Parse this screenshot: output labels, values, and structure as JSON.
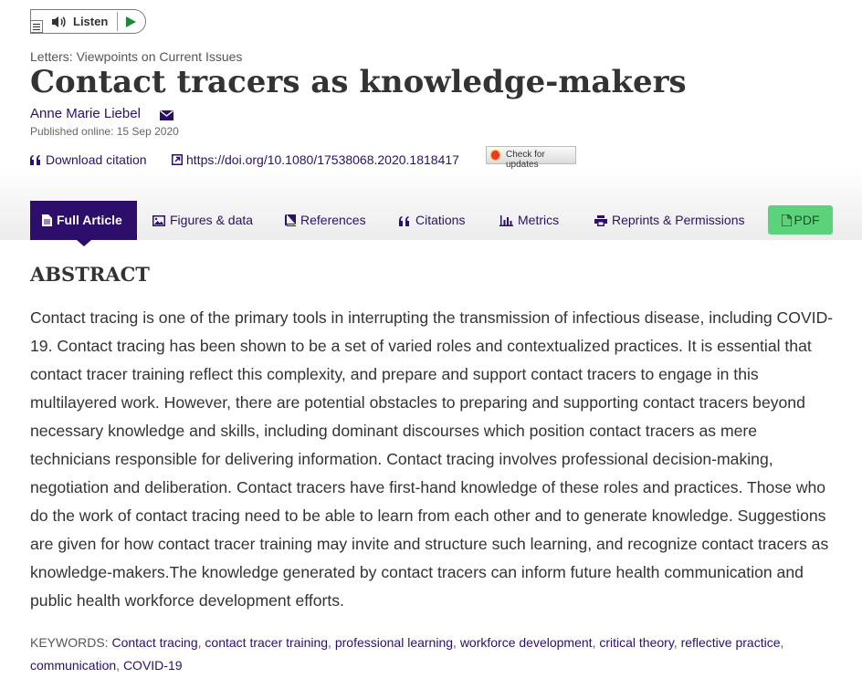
{
  "listen": {
    "label": "Listen"
  },
  "article": {
    "section_type": "Letters: Viewpoints on Current Issues",
    "title": "Contact tracers as knowledge-makers",
    "author": "Anne Marie Liebel",
    "published": "Published online: 15 Sep 2020"
  },
  "tools": {
    "download_citation": "Download citation",
    "doi": "https://doi.org/10.1080/17538068.2020.1818417",
    "check_updates": "Check for updates"
  },
  "tabs": [
    {
      "label": "Full Article",
      "icon": "document-icon",
      "active": true
    },
    {
      "label": "Figures & data",
      "icon": "image-icon"
    },
    {
      "label": "References",
      "icon": "book-icon"
    },
    {
      "label": "Citations",
      "icon": "quote-icon"
    },
    {
      "label": "Metrics",
      "icon": "bar-chart-icon"
    },
    {
      "label": "Reprints & Permissions",
      "icon": "print-icon"
    }
  ],
  "pdf": {
    "label": "PDF"
  },
  "abstract": {
    "heading": "ABSTRACT",
    "text": "Contact tracing is one of the primary tools in interrupting the transmission of infectious disease, including COVID-19. Contact tracing has been shown to be a set of varied roles and contextualized practices. It is essential that contact tracer training reflect this complexity, and prepare and support contact tracers to engage in this multilayered work. However, there are potential obstacles to preparing and supporting contact tracers beyond necessary knowledge and skills, including dominant discourses which position contact tracers as mere technicians responsible for delivering information. Contact tracing involves professional decision-making, negotiation and deliberation. Contact tracers have first-hand knowledge of these roles and practices. Those who do the work of contact tracing need to be able to learn from each other and to generate knowledge. Suggestions are given for how contact tracer training may invite and structure such learning, and recognize contact tracers as knowledge-makers.The knowledge generated by contact tracers can inform future health communication and public health workforce development efforts."
  },
  "keywords": {
    "label": "KEYWORDS:",
    "items": [
      "Contact tracing",
      "contact tracer training",
      "professional learning",
      "workforce development",
      "critical theory",
      "reflective practice",
      "communication",
      "COVID-19"
    ]
  },
  "colors": {
    "brand": "#2d0f6b",
    "pdf_button": "#5cd27a",
    "play": "#1f8a3d"
  }
}
